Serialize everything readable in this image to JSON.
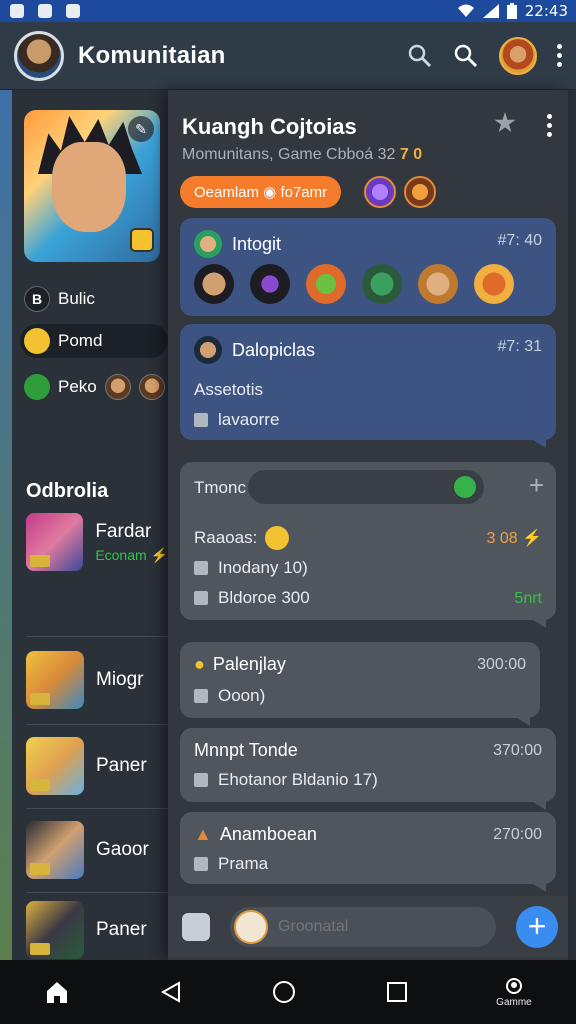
{
  "status_bar": {
    "time": "22:43"
  },
  "app_bar": {
    "title": "Komunitaian"
  },
  "left": {
    "chips": [
      {
        "label": "Bulic",
        "badge": "B"
      },
      {
        "label": "Pomd"
      },
      {
        "label": "Peko"
      }
    ],
    "section_title": "Odbrolia",
    "friends": [
      {
        "name": "Fardar",
        "status": "Econam ⚡"
      },
      {
        "name": "Miogr"
      },
      {
        "name": "Paner"
      },
      {
        "name": "Gaoor"
      },
      {
        "name": "Paner"
      }
    ]
  },
  "panel": {
    "title": "Kuangh Cojtoias",
    "subtitle": "Momunitans, Game Cbboá 32",
    "subtitle_accent": "7 0",
    "tag": "Oeamlam ◉ fo7amr",
    "cards": [
      {
        "title": "Intogit",
        "time": "#7: 40"
      },
      {
        "title": "Dalopiclas",
        "time": "#7: 31",
        "line1": "Assetotis",
        "line2": "lavaorre"
      },
      {
        "input_label": "Tmonc",
        "line0": "Raaoas:",
        "time": "3 08 ⚡",
        "line1": "Inodany 10)",
        "line2": "Bldoroe 300",
        "badge": "5nrt"
      },
      {
        "title": "Palenjlay",
        "time": "300:00",
        "line1": "Ooon)"
      },
      {
        "title": "Mnnpt Tonde",
        "time": "370:00",
        "line1": "Ehotanor Bldanio 17)"
      },
      {
        "title": "Anamboean",
        "time": "270:00",
        "line1": "Prama"
      }
    ]
  },
  "compose": {
    "placeholder": "Groonatal"
  },
  "navbar": {
    "profile_label": "Gamme"
  },
  "colors": {
    "accent_orange": "#f47c2a",
    "blue_card": "#3d5483",
    "fab_blue": "#3a8df0",
    "status_green": "#37c04a"
  }
}
